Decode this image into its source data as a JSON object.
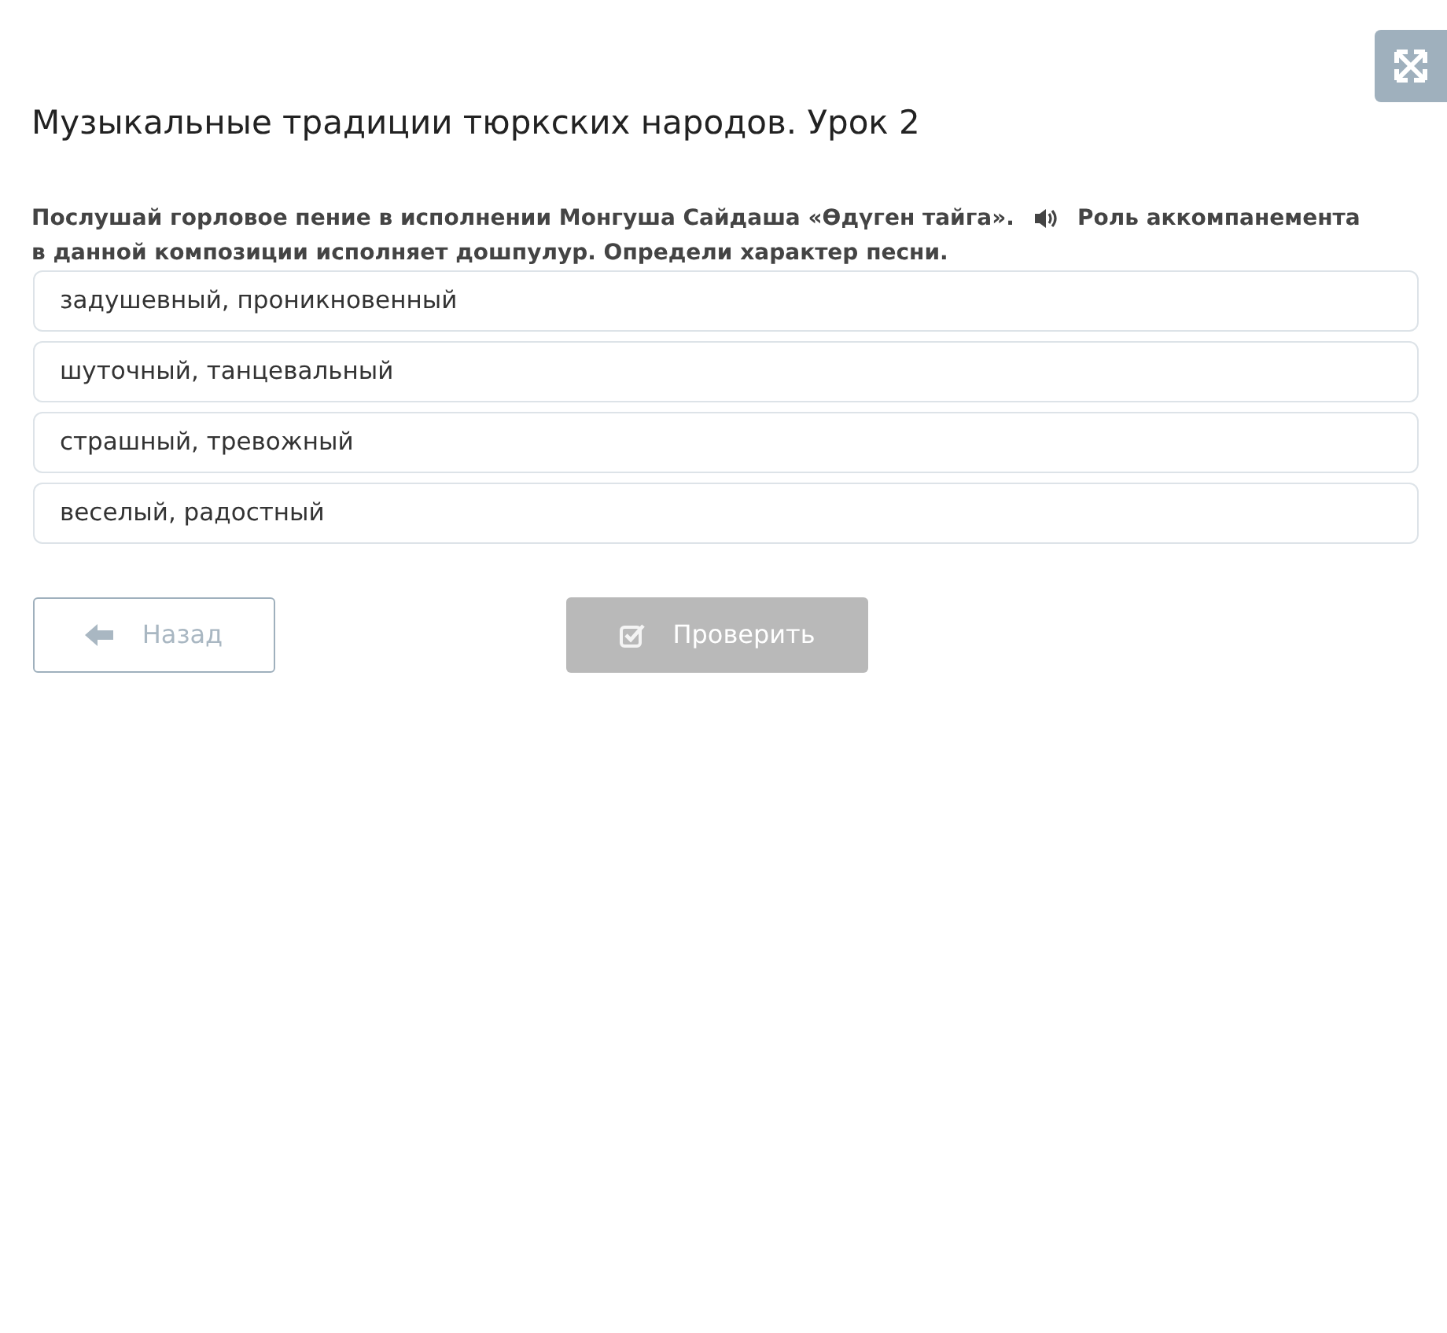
{
  "title": "Музыкальные традиции тюркских народов. Урок 2",
  "question": {
    "before_audio": "Послушай горловое пение в исполнении Монгуша Сайдаша «Өдүген тайга».",
    "after_audio": "Роль аккомпанемента",
    "second_line": "в данной композиции исполняет дошпулур. Определи характер песни."
  },
  "options": [
    {
      "label": "задушевный, проникновенный",
      "selected": false
    },
    {
      "label": "шуточный, танцевальный",
      "selected": false
    },
    {
      "label": "страшный, тревожный",
      "selected": false
    },
    {
      "label": "веселый, радостный",
      "selected": false
    }
  ],
  "back_button": {
    "label": "Назад"
  },
  "check_button": {
    "label": "Проверить",
    "disabled": true
  }
}
